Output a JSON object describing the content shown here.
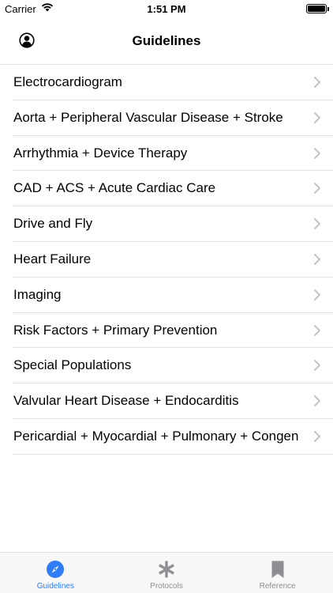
{
  "status_bar": {
    "carrier": "Carrier",
    "time": "1:51 PM",
    "battery_level": 1.0
  },
  "header": {
    "title": "Guidelines",
    "profile_icon": "person-circle-icon"
  },
  "guidelines": {
    "items": [
      {
        "label": "Electrocardiogram"
      },
      {
        "label": "Aorta + Peripheral Vascular Disease + Stroke"
      },
      {
        "label": "Arrhythmia + Device Therapy"
      },
      {
        "label": "CAD + ACS + Acute Cardiac Care"
      },
      {
        "label": "Drive and Fly"
      },
      {
        "label": "Heart Failure"
      },
      {
        "label": "Imaging"
      },
      {
        "label": "Risk Factors + Primary Prevention"
      },
      {
        "label": "Special Populations"
      },
      {
        "label": "Valvular Heart Disease + Endocarditis"
      },
      {
        "label": "Pericardial + Myocardial + Pulmonary + Congen"
      }
    ]
  },
  "tab_bar": {
    "tabs": [
      {
        "label": "Guidelines",
        "icon": "compass-icon",
        "active": true
      },
      {
        "label": "Protocols",
        "icon": "asterisk-icon",
        "active": false
      },
      {
        "label": "Reference",
        "icon": "bookmark-icon",
        "active": false
      }
    ],
    "active_color": "#2f7cf6",
    "inactive_color": "#8e8e93"
  }
}
